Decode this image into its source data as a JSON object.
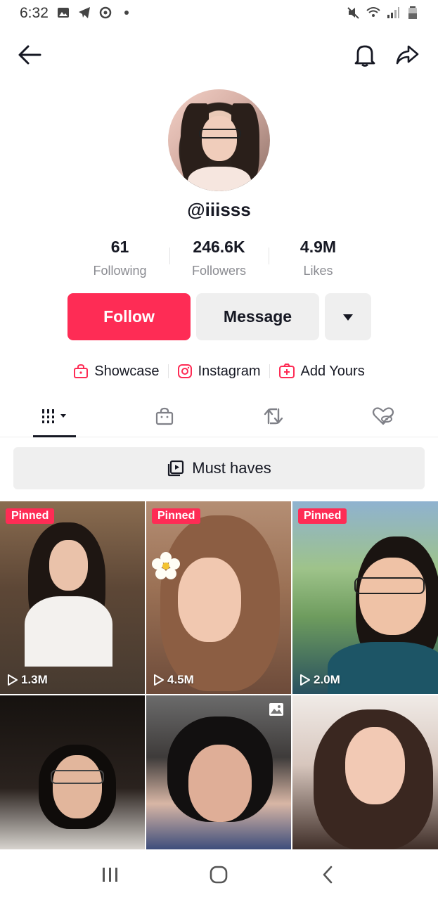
{
  "status_bar": {
    "time": "6:32"
  },
  "profile": {
    "username": "@iiisss",
    "stats": [
      {
        "value": "61",
        "label": "Following"
      },
      {
        "value": "246.6K",
        "label": "Followers"
      },
      {
        "value": "4.9M",
        "label": "Likes"
      }
    ]
  },
  "actions": {
    "follow": "Follow",
    "message": "Message"
  },
  "links": [
    {
      "label": "Showcase",
      "icon": "shopping-bag-icon"
    },
    {
      "label": "Instagram",
      "icon": "instagram-icon"
    },
    {
      "label": "Add Yours",
      "icon": "add-yours-icon"
    }
  ],
  "tabs": [
    {
      "name": "videos",
      "icon": "grid-icon",
      "active": true
    },
    {
      "name": "shop",
      "icon": "shopping-bag-icon",
      "active": false
    },
    {
      "name": "reposts",
      "icon": "repost-icon",
      "active": false
    },
    {
      "name": "liked",
      "icon": "hidden-heart-icon",
      "active": false
    }
  ],
  "must_haves": {
    "label": "Must haves"
  },
  "videos": [
    {
      "pinned_label": "Pinned",
      "views": "1.3M"
    },
    {
      "pinned_label": "Pinned",
      "views": "4.5M"
    },
    {
      "pinned_label": "Pinned",
      "views": "2.0M"
    },
    {
      "pinned_label": "",
      "views": ""
    },
    {
      "pinned_label": "",
      "views": ""
    },
    {
      "pinned_label": "",
      "views": ""
    }
  ],
  "colors": {
    "accent": "#fe2c55",
    "text": "#161823",
    "muted": "#8a8b91",
    "button_gray": "#efefef"
  }
}
